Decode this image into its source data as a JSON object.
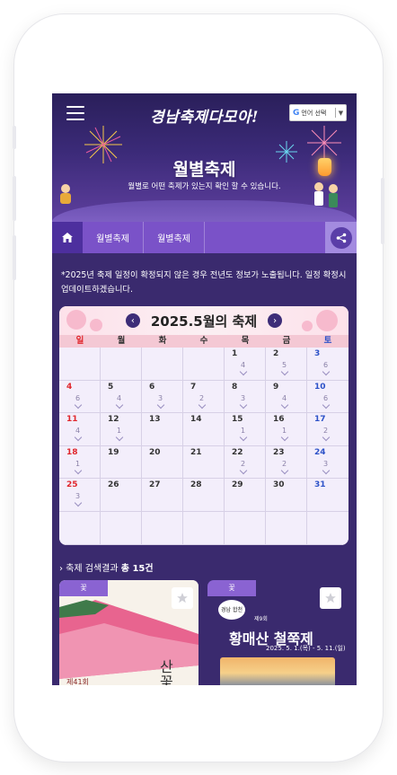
{
  "header": {
    "logo_text": "경남축제다모아!",
    "lang_button": "언어 선택",
    "lang_button_g": "G",
    "title": "월별축제",
    "subtitle": "월별로 어떤 축제가 있는지 확인 할 수 있습니다."
  },
  "tabs": {
    "items": [
      "월별축제",
      "월별축제"
    ]
  },
  "notice": "*2025년 축제 일정이 확정되지 않은 경우 전년도 정보가 노출됩니다. 일정 확정시 업데이트하겠습니다.",
  "calendar": {
    "title": "2025.5월의 축제",
    "days_of_week": [
      "일",
      "월",
      "화",
      "수",
      "목",
      "금",
      "토"
    ],
    "weeks": [
      [
        {
          "d": "",
          "c": ""
        },
        {
          "d": "",
          "c": ""
        },
        {
          "d": "",
          "c": ""
        },
        {
          "d": "",
          "c": ""
        },
        {
          "d": "1",
          "c": "4"
        },
        {
          "d": "2",
          "c": "5"
        },
        {
          "d": "3",
          "c": "6"
        }
      ],
      [
        {
          "d": "4",
          "c": "6"
        },
        {
          "d": "5",
          "c": "4"
        },
        {
          "d": "6",
          "c": "3"
        },
        {
          "d": "7",
          "c": "2"
        },
        {
          "d": "8",
          "c": "3"
        },
        {
          "d": "9",
          "c": "4"
        },
        {
          "d": "10",
          "c": "6"
        }
      ],
      [
        {
          "d": "11",
          "c": "4"
        },
        {
          "d": "12",
          "c": "1"
        },
        {
          "d": "13",
          "c": ""
        },
        {
          "d": "14",
          "c": ""
        },
        {
          "d": "15",
          "c": "1"
        },
        {
          "d": "16",
          "c": "1"
        },
        {
          "d": "17",
          "c": "2"
        }
      ],
      [
        {
          "d": "18",
          "c": "1"
        },
        {
          "d": "19",
          "c": ""
        },
        {
          "d": "20",
          "c": ""
        },
        {
          "d": "21",
          "c": ""
        },
        {
          "d": "22",
          "c": "2"
        },
        {
          "d": "23",
          "c": "2"
        },
        {
          "d": "24",
          "c": "3"
        }
      ],
      [
        {
          "d": "25",
          "c": "3"
        },
        {
          "d": "26",
          "c": ""
        },
        {
          "d": "27",
          "c": ""
        },
        {
          "d": "28",
          "c": ""
        },
        {
          "d": "29",
          "c": ""
        },
        {
          "d": "30",
          "c": ""
        },
        {
          "d": "31",
          "c": ""
        }
      ],
      [
        {
          "d": "",
          "c": ""
        },
        {
          "d": "",
          "c": ""
        },
        {
          "d": "",
          "c": ""
        },
        {
          "d": "",
          "c": ""
        },
        {
          "d": "",
          "c": ""
        },
        {
          "d": "",
          "c": ""
        },
        {
          "d": "",
          "c": ""
        }
      ]
    ]
  },
  "results": {
    "prefix": "축제 검색결과",
    "count": "총 15건"
  },
  "cards": [
    {
      "badge": "꽃",
      "poster_text": "제41회",
      "poster_big": "산 꽃"
    },
    {
      "badge": "꽃",
      "title": "황매산 철쭉제",
      "date": "2025. 5. 1.(목) - 5. 11.(일)",
      "edition": "제9회",
      "bubble": "경남 합천"
    }
  ],
  "colors": {
    "background": "#3a2a6e",
    "tab_bar": "#7a52c8",
    "home_tab": "#4d2f9e",
    "calendar_bg": "#f3eefb",
    "sunday": "#e0262c",
    "saturday": "#2d52c8"
  },
  "icons": {
    "menu": "hamburger-icon",
    "home": "home-icon",
    "share": "share-icon",
    "prev": "chevron-left-icon",
    "next": "chevron-right-icon",
    "favorite": "star-icon"
  }
}
